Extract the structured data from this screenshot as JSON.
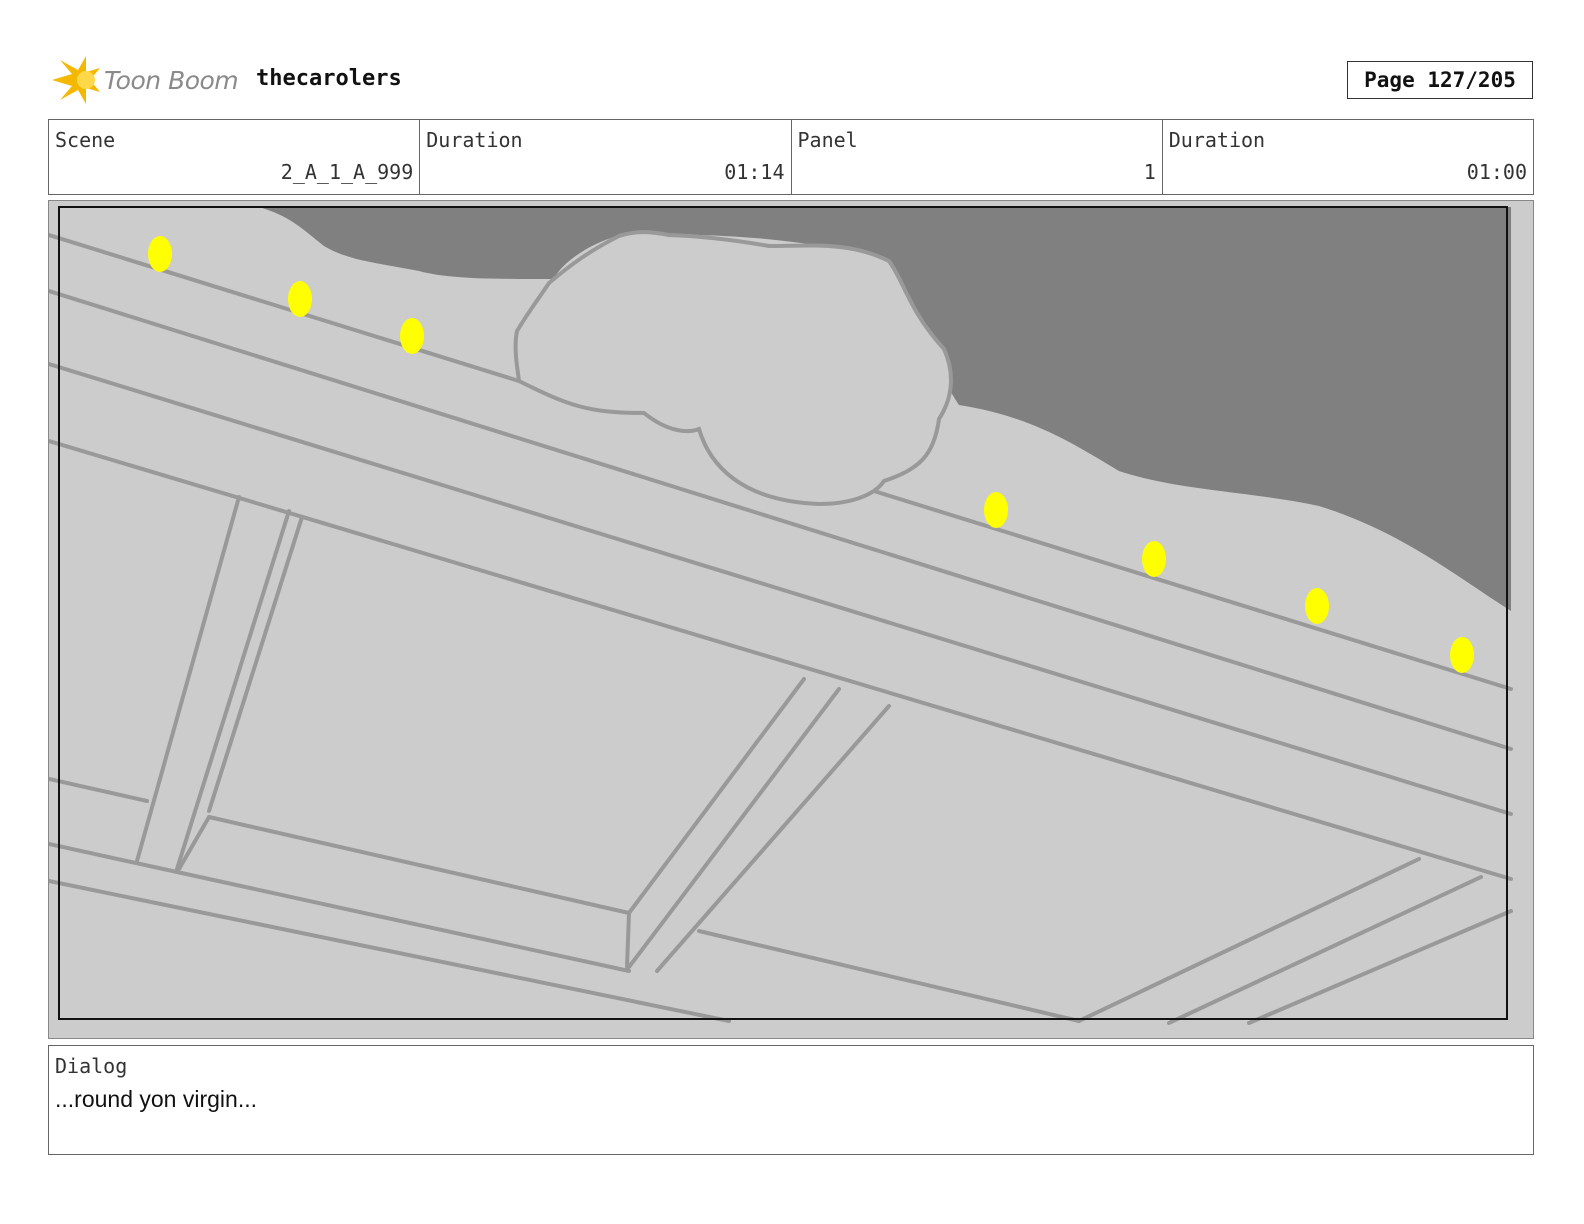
{
  "header": {
    "logo_text": "Toon Boom",
    "project_title": "thecarolers",
    "page_label": "Page 127/205"
  },
  "info": {
    "scene_label": "Scene",
    "scene_value": "2_A_1_A_999",
    "scene_duration_label": "Duration",
    "scene_duration_value": "01:14",
    "panel_label": "Panel",
    "panel_value": "1",
    "panel_duration_label": "Duration",
    "panel_duration_value": "01:00"
  },
  "panel": {
    "sky_color": "#808080",
    "surface_color": "#cccccc",
    "line_color": "#999999",
    "light_color": "#ffff00",
    "light_count": 7
  },
  "dialog": {
    "label": "Dialog",
    "text": "...round yon virgin..."
  }
}
